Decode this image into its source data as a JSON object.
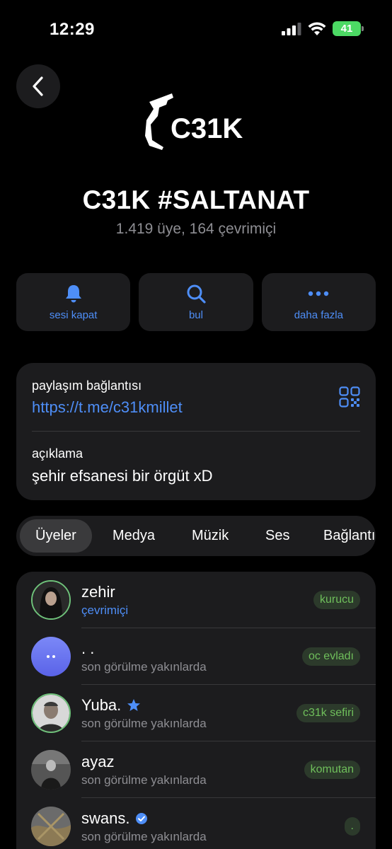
{
  "status_bar": {
    "time": "12:29",
    "battery": "41"
  },
  "group": {
    "logo_text": "C31K",
    "title": "C31K #SALTANAT",
    "subtitle": "1.419 üye, 164 çevrimiçi"
  },
  "actions": [
    {
      "label": "sesi kapat",
      "icon": "bell-icon"
    },
    {
      "label": "bul",
      "icon": "search-icon"
    },
    {
      "label": "daha fazla",
      "icon": "more-icon"
    }
  ],
  "info": {
    "link_caption": "paylaşım bağlantısı",
    "link_value": "https://t.me/c31kmillet",
    "description_caption": "açıklama",
    "description_value": "şehir efsanesi bir örgüt xD"
  },
  "tabs": [
    {
      "label": "Üyeler",
      "active": true
    },
    {
      "label": "Medya"
    },
    {
      "label": "Müzik"
    },
    {
      "label": "Ses"
    },
    {
      "label": "Bağlantılar"
    }
  ],
  "members": [
    {
      "name": "zehir",
      "status": "çevrimiçi",
      "badge": "kurucu",
      "online": true
    },
    {
      "name": ". .",
      "status": "son görülme yakınlarda",
      "badge": "oc evladı"
    },
    {
      "name": "Yuba.",
      "status": "son görülme yakınlarda",
      "badge": "c31k sefiri",
      "name_icon": "star-icon"
    },
    {
      "name": "ayaz",
      "status": "son görülme yakınlarda",
      "badge": "komutan"
    },
    {
      "name": "swans.",
      "status": "son görülme yakınlarda",
      "badge": ".",
      "name_icon": "verified-icon"
    }
  ],
  "colors": {
    "accent": "#4e8ef7",
    "badge_text": "#6fbf5b",
    "card": "#1c1c1e"
  }
}
